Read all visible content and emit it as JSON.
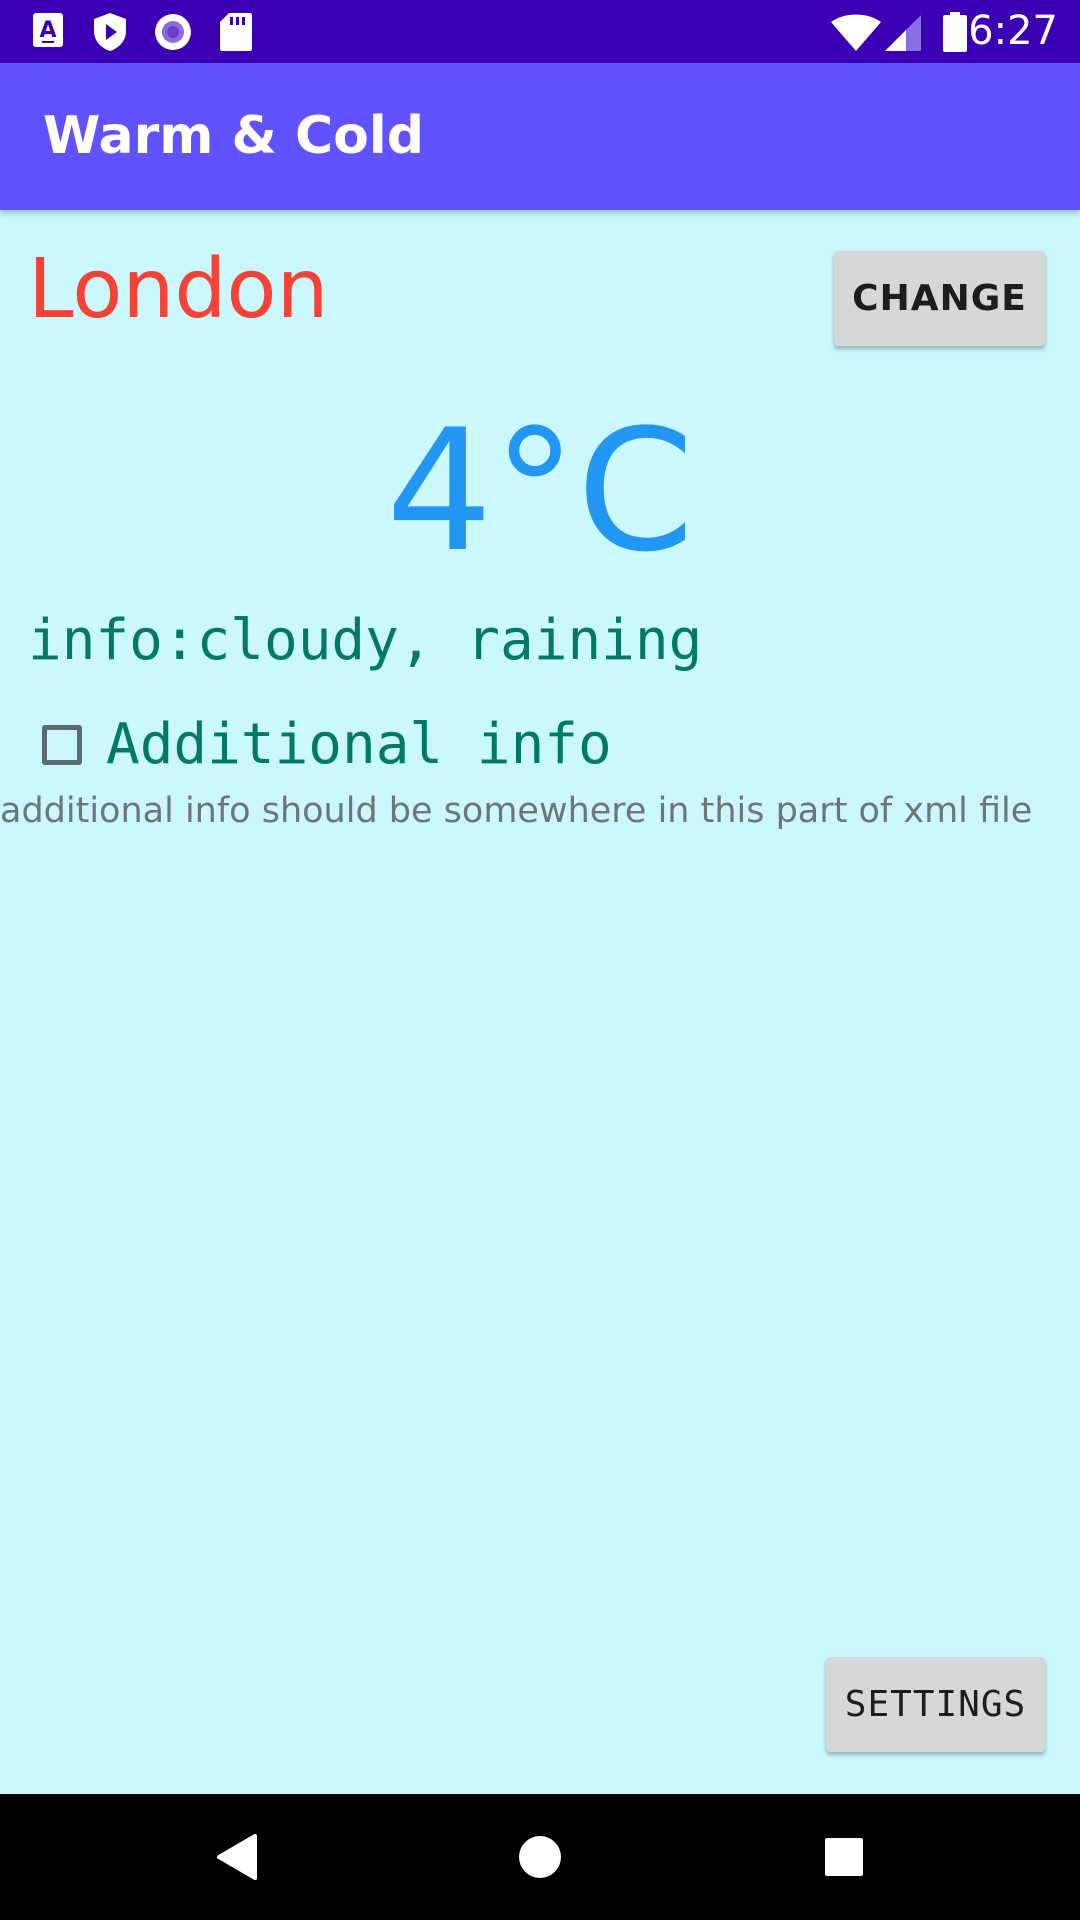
{
  "status_bar": {
    "time": "6:27",
    "left_icons": [
      "a-keyboard-icon",
      "shield-play-icon",
      "circle-record-icon",
      "sd-card-icon"
    ],
    "right_icons": [
      "wifi-icon",
      "signal-icon",
      "battery-icon"
    ],
    "background_color": "#3c00b4"
  },
  "app_bar": {
    "title": "Warm & Cold",
    "background_color": "#6053ff"
  },
  "main": {
    "city": "London",
    "city_color": "#f44336",
    "change_button_label": "CHANGE",
    "temperature": "4°C",
    "temperature_color": "#2196f3",
    "info": "info:cloudy, raining",
    "additional_info_checkbox": {
      "label": "Additional info",
      "checked": false
    },
    "hint": "additional info should be somewhere in this part of xml file",
    "settings_button_label": "SETTINGS",
    "background_color": "#cbf7fe"
  },
  "nav_bar": {
    "buttons": [
      "back-icon",
      "home-icon",
      "recents-icon"
    ]
  }
}
